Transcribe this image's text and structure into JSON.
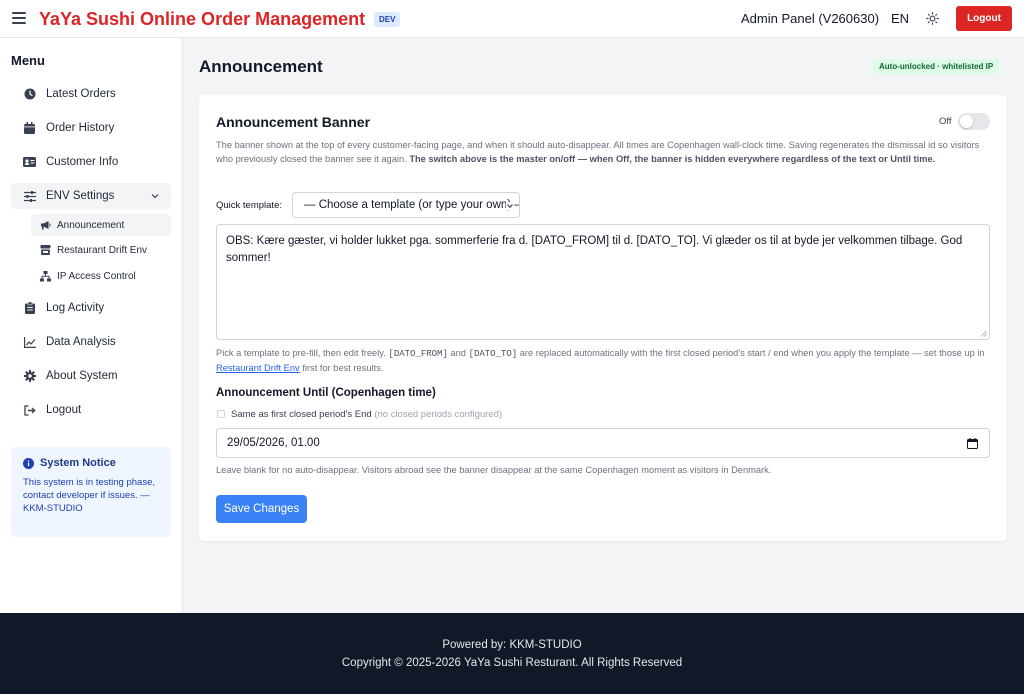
{
  "header": {
    "title": "YaYa Sushi Online Order Management",
    "env_badge": "DEV",
    "admin_label": "Admin Panel (V260630)",
    "language": "EN",
    "logout_label": "Logout",
    "brand_color": "#dc2626"
  },
  "sidebar": {
    "menu_title": "Menu",
    "items": [
      {
        "label": "Latest Orders",
        "icon": "clock-icon"
      },
      {
        "label": "Order History",
        "icon": "calendar-icon"
      },
      {
        "label": "Customer Info",
        "icon": "id-card-icon"
      },
      {
        "label": "ENV Settings",
        "icon": "sliders-icon",
        "expanded": true
      },
      {
        "label": "Log Activity",
        "icon": "clipboard-icon"
      },
      {
        "label": "Data Analysis",
        "icon": "chart-line-icon"
      },
      {
        "label": "About System",
        "icon": "gear-icon"
      },
      {
        "label": "Logout",
        "icon": "sign-out-icon"
      }
    ],
    "sub_items": [
      {
        "label": "Announcement",
        "icon": "megaphone-icon",
        "active": true
      },
      {
        "label": "Restaurant Drift Env",
        "icon": "store-icon"
      },
      {
        "label": "IP Access Control",
        "icon": "network-icon"
      }
    ],
    "notice": {
      "title": "System Notice",
      "text": "This system is in testing phase, contact developer if issues. — KKM-STUDIO"
    }
  },
  "main": {
    "page_title": "Announcement",
    "status_badge": "Auto-unlocked · whitelisted IP",
    "card": {
      "title": "Announcement Banner",
      "toggle_label": "Off",
      "toggle_on": false,
      "description": "The banner shown at the top of every customer-facing page, and when it should auto-disappear. All times are Copenhagen wall-clock time. Saving regenerates the dismissal id so visitors who previously closed the banner see it again.",
      "description_bold": "The switch above is the master on/off — when Off, the banner is hidden everywhere regardless of the text or Until time.",
      "quick_template_label": "Quick template:",
      "quick_template_value": "— Choose a template (or type your own) —",
      "message": "OBS: Kære gæster, vi holder lukket pga. sommerferie fra d. [DATO_FROM] til d. [DATO_TO]. Vi glæder os til at byde jer velkommen tilbage. God sommer!",
      "hint_1": "Pick a template to pre-fill, then edit freely.",
      "hint_token_from": "[DATO_FROM]",
      "hint_2": "and",
      "hint_token_to": "[DATO_TO]",
      "hint_3": "are replaced automatically with the first closed period's start / end when you apply the template — set those up in",
      "hint_link": "Restaurant Drift Env",
      "hint_4": "first for best results.",
      "until_title": "Announcement Until (Copenhagen time)",
      "checkbox_label": "Same as first closed period's End",
      "checkbox_note": "(no closed periods configured)",
      "checkbox_checked": false,
      "until_value": "29/05/2026, 01.00",
      "until_hint": "Leave blank for no auto-disappear. Visitors abroad see the banner disappear at the same Copenhagen moment as visitors in Denmark.",
      "save_label": "Save Changes"
    }
  },
  "footer": {
    "line1": "Powered by: KKM-STUDIO",
    "line2": "Copyright © 2025-2026 YaYa Sushi Resturant. All Rights Reserved"
  }
}
